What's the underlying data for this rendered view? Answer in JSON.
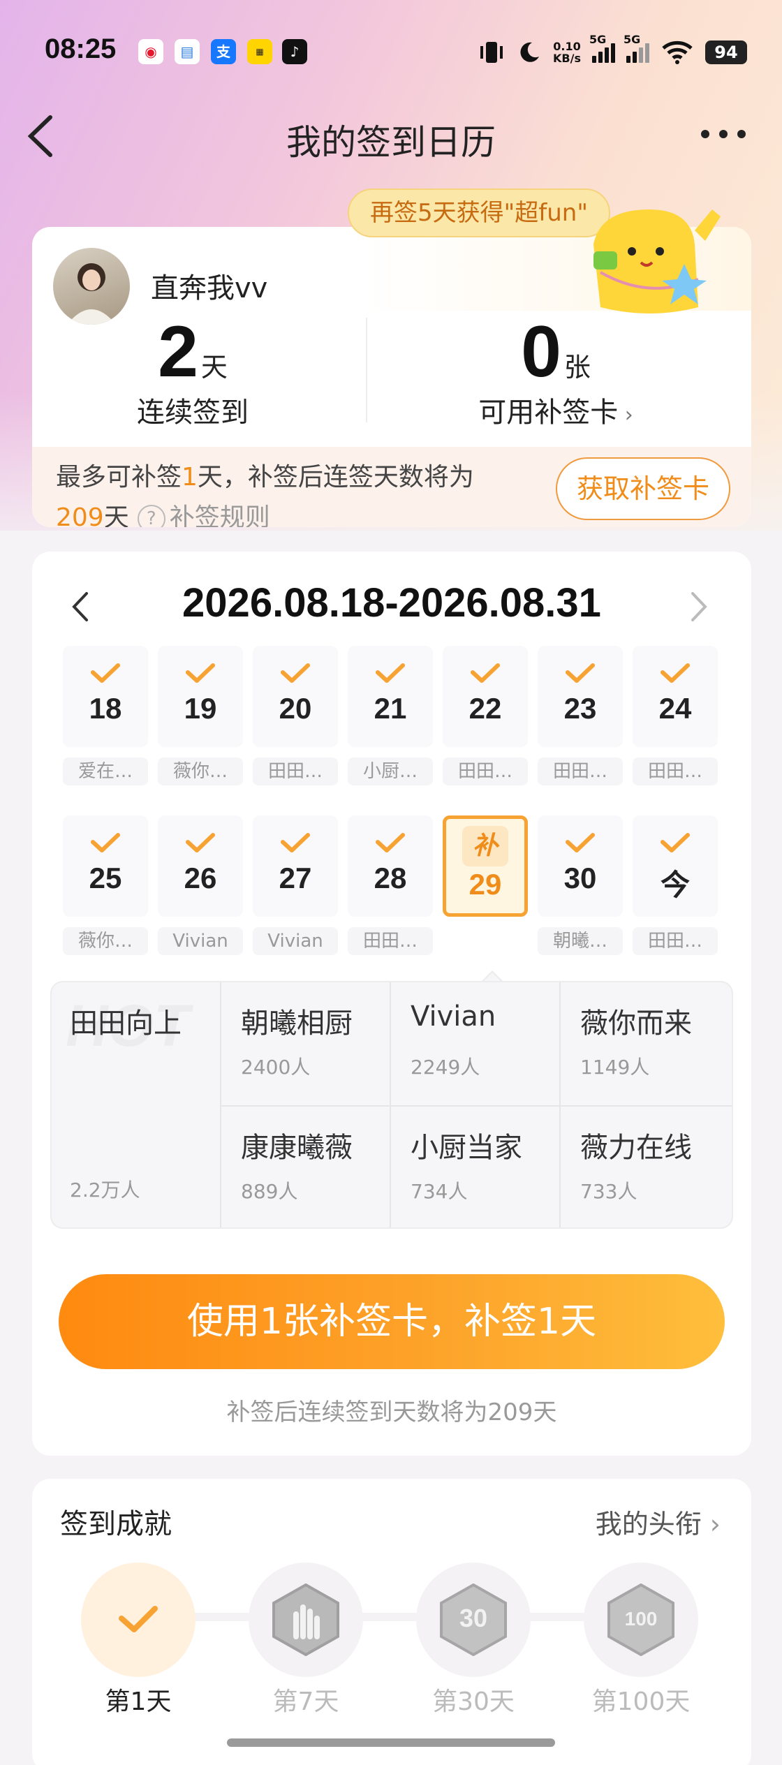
{
  "status_bar": {
    "time": "08:25",
    "net_speed_value": "0.10",
    "net_speed_unit": "KB/s",
    "sim1": "5G",
    "sim2": "5G",
    "battery": "94"
  },
  "header": {
    "title": "我的签到日历"
  },
  "promo": {
    "text": "再签5天获得\"超fun\""
  },
  "user": {
    "name": "直奔我vv",
    "streak_value": "2",
    "streak_unit": "天",
    "streak_label": "连续签到",
    "cards_value": "0",
    "cards_unit": "张",
    "cards_label": "可用补签卡",
    "makeup_prefix": "最多可补签",
    "makeup_days": "1",
    "makeup_mid": "天，补签后连签天数将为",
    "makeup_total": "209",
    "makeup_total_unit": "天",
    "rule_label": "补签规则",
    "get_card_button": "获取补签卡"
  },
  "calendar": {
    "range": "2026.08.18-2026.08.31",
    "week1": [
      {
        "day": "18",
        "label": "爱在…"
      },
      {
        "day": "19",
        "label": "薇你…"
      },
      {
        "day": "20",
        "label": "田田…"
      },
      {
        "day": "21",
        "label": "小厨…"
      },
      {
        "day": "22",
        "label": "田田…"
      },
      {
        "day": "23",
        "label": "田田…"
      },
      {
        "day": "24",
        "label": "田田…"
      }
    ],
    "week2": [
      {
        "day": "25",
        "label": "薇你…"
      },
      {
        "day": "26",
        "label": "Vivian"
      },
      {
        "day": "27",
        "label": "Vivian"
      },
      {
        "day": "28",
        "label": "田田…"
      },
      {
        "day": "29",
        "label": "",
        "badge": "补"
      },
      {
        "day": "30",
        "label": "朝曦…"
      },
      {
        "day": "今",
        "label": "田田…"
      }
    ],
    "groups": [
      {
        "name": "田田向上",
        "count": "2.2万人"
      },
      {
        "name": "朝曦相厨",
        "count": "2400人"
      },
      {
        "name": "Vivian",
        "count": "2249人"
      },
      {
        "name": "薇你而来",
        "count": "1149人"
      },
      {
        "name": "康康曦薇",
        "count": "889人"
      },
      {
        "name": "小厨当家",
        "count": "734人"
      },
      {
        "name": "薇力在线",
        "count": "733人"
      }
    ],
    "watermark": "HOT",
    "cta": "使用1张补签卡，补签1天",
    "cta_note": "补签后连续签到天数将为209天"
  },
  "achievements": {
    "title": "签到成就",
    "link": "我的头衔",
    "items": [
      {
        "label": "第1天",
        "badge": "check"
      },
      {
        "label": "第7天",
        "badge": "hand-icon"
      },
      {
        "label": "第30天",
        "badge": "30"
      },
      {
        "label": "第100天",
        "badge": "100"
      }
    ]
  },
  "colors": {
    "accent": "#f08d1a",
    "cta_start": "#ff8a10",
    "cta_end": "#ffbe3c",
    "check": "#f7a334"
  }
}
